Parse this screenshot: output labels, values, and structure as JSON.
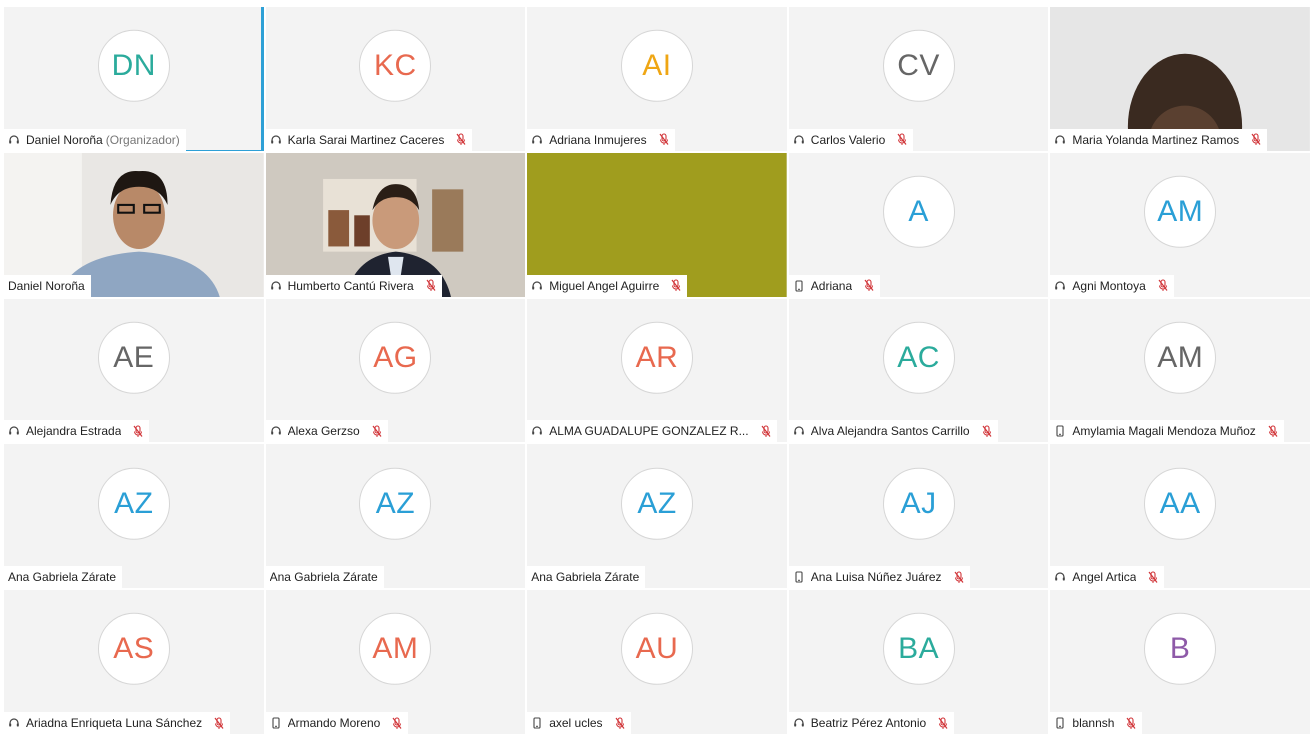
{
  "colors": {
    "tile_bg": "#f3f3f3",
    "active_border": "#2ea0d6",
    "mute_red": "#d13438"
  },
  "participants": [
    {
      "initials": "DN",
      "name": "Daniel Noroña",
      "role": "(Organizador)",
      "color": "#2bab9c",
      "device": "headset",
      "muted": false,
      "video": null,
      "active": true
    },
    {
      "initials": "KC",
      "name": "Karla Sarai Martinez Caceres",
      "color": "#e8694f",
      "device": "headset",
      "muted": true,
      "video": null
    },
    {
      "initials": "AI",
      "name": "Adriana Inmujeres",
      "color": "#efa614",
      "device": "headset",
      "muted": true,
      "video": null
    },
    {
      "initials": "CV",
      "name": "Carlos Valerio",
      "color": "#666666",
      "device": "headset",
      "muted": true,
      "video": null
    },
    {
      "initials": "",
      "name": "Maria Yolanda Martinez Ramos",
      "color": "#666666",
      "device": "headset",
      "muted": true,
      "video": "person-dark"
    },
    {
      "initials": "",
      "name": "Daniel Noroña",
      "color": "#666666",
      "device": "none",
      "muted": false,
      "video": "person-glasses"
    },
    {
      "initials": "",
      "name": "Humberto Cantú Rivera",
      "color": "#666666",
      "device": "headset",
      "muted": true,
      "video": "person-suit"
    },
    {
      "initials": "",
      "name": "Miguel Angel Aguirre",
      "color": "#666666",
      "device": "headset",
      "muted": true,
      "video": "green-wall"
    },
    {
      "initials": "A",
      "name": "Adriana",
      "color": "#2a9fd6",
      "device": "phone",
      "muted": true,
      "video": null
    },
    {
      "initials": "AM",
      "name": "Agni Montoya",
      "color": "#2a9fd6",
      "device": "headset",
      "muted": true,
      "video": null
    },
    {
      "initials": "AE",
      "name": "Alejandra Estrada",
      "color": "#666666",
      "device": "headset",
      "muted": true,
      "video": null
    },
    {
      "initials": "AG",
      "name": "Alexa Gerzso",
      "color": "#e8694f",
      "device": "headset",
      "muted": true,
      "video": null
    },
    {
      "initials": "AR",
      "name": "ALMA GUADALUPE GONZALEZ R...",
      "color": "#e8694f",
      "device": "headset",
      "muted": true,
      "video": null
    },
    {
      "initials": "AC",
      "name": "Alva Alejandra Santos Carrillo",
      "color": "#2bab9c",
      "device": "headset",
      "muted": true,
      "video": null
    },
    {
      "initials": "AM",
      "name": "Amylamia Magali Mendoza Muñoz",
      "color": "#666666",
      "device": "phone",
      "muted": true,
      "video": null
    },
    {
      "initials": "AZ",
      "name": "Ana Gabriela Zárate",
      "color": "#2a9fd6",
      "device": "none",
      "muted": false,
      "video": null
    },
    {
      "initials": "AZ",
      "name": "Ana Gabriela Zárate",
      "color": "#2a9fd6",
      "device": "none",
      "muted": false,
      "video": null
    },
    {
      "initials": "AZ",
      "name": "Ana Gabriela Zárate",
      "color": "#2a9fd6",
      "device": "none",
      "muted": false,
      "video": null
    },
    {
      "initials": "AJ",
      "name": "Ana Luisa Núñez Juárez",
      "color": "#2a9fd6",
      "device": "phone",
      "muted": true,
      "video": null
    },
    {
      "initials": "AA",
      "name": "Angel Artica",
      "color": "#2a9fd6",
      "device": "headset",
      "muted": true,
      "video": null
    },
    {
      "initials": "AS",
      "name": "Ariadna Enriqueta Luna Sánchez",
      "color": "#e8694f",
      "device": "headset",
      "muted": true,
      "video": null
    },
    {
      "initials": "AM",
      "name": "Armando Moreno",
      "color": "#e8694f",
      "device": "phone",
      "muted": true,
      "video": null
    },
    {
      "initials": "AU",
      "name": "axel ucles",
      "color": "#e8694f",
      "device": "phone",
      "muted": true,
      "video": null
    },
    {
      "initials": "BA",
      "name": "Beatriz Pérez Antonio",
      "color": "#2bab9c",
      "device": "headset",
      "muted": true,
      "video": null
    },
    {
      "initials": "B",
      "name": "blannsh",
      "color": "#8e5aa8",
      "device": "phone",
      "muted": true,
      "video": null
    }
  ]
}
